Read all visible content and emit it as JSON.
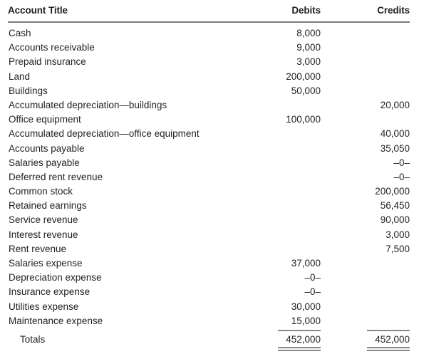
{
  "headers": {
    "account_title": "Account Title",
    "debits": "Debits",
    "credits": "Credits"
  },
  "rows": [
    {
      "account": "Cash",
      "debit": "8,000",
      "credit": ""
    },
    {
      "account": "Accounts receivable",
      "debit": "9,000",
      "credit": ""
    },
    {
      "account": "Prepaid insurance",
      "debit": "3,000",
      "credit": ""
    },
    {
      "account": "Land",
      "debit": "200,000",
      "credit": ""
    },
    {
      "account": "Buildings",
      "debit": "50,000",
      "credit": ""
    },
    {
      "account": "Accumulated depreciation—buildings",
      "debit": "",
      "credit": "20,000"
    },
    {
      "account": "Office equipment",
      "debit": "100,000",
      "credit": ""
    },
    {
      "account": "Accumulated depreciation—office equipment",
      "debit": "",
      "credit": "40,000"
    },
    {
      "account": "Accounts payable",
      "debit": "",
      "credit": "35,050"
    },
    {
      "account": "Salaries payable",
      "debit": "",
      "credit": "–0–"
    },
    {
      "account": "Deferred rent revenue",
      "debit": "",
      "credit": "–0–"
    },
    {
      "account": "Common stock",
      "debit": "",
      "credit": "200,000"
    },
    {
      "account": "Retained earnings",
      "debit": "",
      "credit": "56,450"
    },
    {
      "account": "Service revenue",
      "debit": "",
      "credit": "90,000"
    },
    {
      "account": "Interest revenue",
      "debit": "",
      "credit": "3,000"
    },
    {
      "account": "Rent revenue",
      "debit": "",
      "credit": "7,500"
    },
    {
      "account": "Salaries expense",
      "debit": "37,000",
      "credit": ""
    },
    {
      "account": "Depreciation expense",
      "debit": "–0–",
      "credit": ""
    },
    {
      "account": "Insurance expense",
      "debit": "–0–",
      "credit": ""
    },
    {
      "account": "Utilities expense",
      "debit": "30,000",
      "credit": ""
    },
    {
      "account": "Maintenance expense",
      "debit": "15,000",
      "credit": ""
    }
  ],
  "totals": {
    "label": "Totals",
    "debit": "452,000",
    "credit": "452,000"
  }
}
